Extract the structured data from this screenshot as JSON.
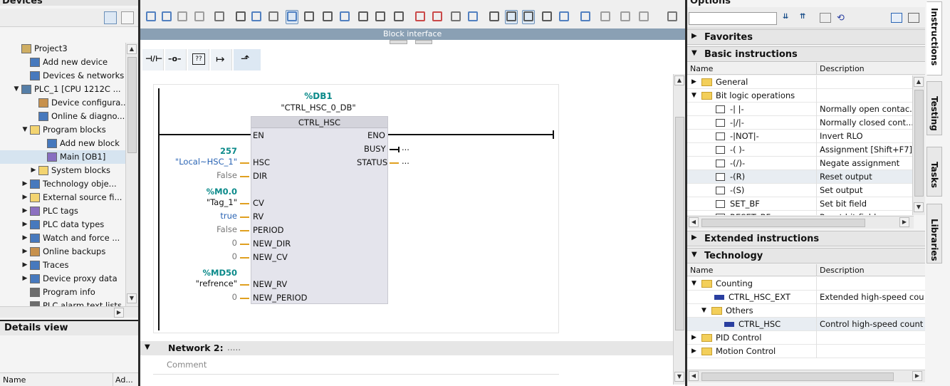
{
  "left_panel": {
    "header": "Devices",
    "tree": [
      {
        "label": "Project3",
        "expand": "",
        "icon": "project"
      },
      {
        "label": "Add new device",
        "expand": "",
        "icon": "add-device"
      },
      {
        "label": "Devices & networks",
        "expand": "",
        "icon": "network"
      },
      {
        "label": "PLC_1 [CPU 1212C ...",
        "expand": "▼",
        "icon": "plc"
      },
      {
        "label": "Device configura...",
        "expand": "",
        "icon": "device-config"
      },
      {
        "label": "Online & diagno...",
        "expand": "",
        "icon": "diagnostics"
      },
      {
        "label": "Program blocks",
        "expand": "▼",
        "icon": "folder"
      },
      {
        "label": "Add new block",
        "expand": "",
        "icon": "add-block"
      },
      {
        "label": "Main [OB1]",
        "expand": "",
        "icon": "ob-block"
      },
      {
        "label": "System blocks",
        "expand": "▶",
        "icon": "folder"
      },
      {
        "label": "Technology obje...",
        "expand": "▶",
        "icon": "technology"
      },
      {
        "label": "External source fi...",
        "expand": "▶",
        "icon": "folder"
      },
      {
        "label": "PLC tags",
        "expand": "▶",
        "icon": "tags"
      },
      {
        "label": "PLC data types",
        "expand": "▶",
        "icon": "data-types"
      },
      {
        "label": "Watch and force ...",
        "expand": "▶",
        "icon": "watch"
      },
      {
        "label": "Online backups",
        "expand": "▶",
        "icon": "backup"
      },
      {
        "label": "Traces",
        "expand": "▶",
        "icon": "traces"
      },
      {
        "label": "Device proxy data",
        "expand": "▶",
        "icon": "proxy"
      },
      {
        "label": "Program info",
        "expand": "",
        "icon": "info"
      },
      {
        "label": "PLC alarm text lists",
        "expand": "",
        "icon": "alarm"
      }
    ],
    "details_view": "Details view",
    "details_columns": [
      "Name",
      "Ad..."
    ]
  },
  "editor": {
    "block_interface_label": "Block interface",
    "instance_db_address": "%DB1",
    "instance_db_name": "\"CTRL_HSC_0_DB\"",
    "block_name": "CTRL_HSC",
    "inputs": [
      {
        "name": "EN",
        "values": []
      },
      {
        "name": "HSC",
        "values": [
          {
            "text": "257",
            "style": "teal"
          },
          {
            "text": "\"Local~HSC_1\"",
            "style": "blue"
          }
        ]
      },
      {
        "name": "DIR",
        "values": [
          {
            "text": "False",
            "style": "grey"
          }
        ]
      },
      {
        "name": "CV",
        "values": [
          {
            "text": "%M0.0",
            "style": "teal"
          },
          {
            "text": "\"Tag_1\"",
            "style": "blk"
          }
        ]
      },
      {
        "name": "RV",
        "values": [
          {
            "text": "true",
            "style": "blue"
          }
        ]
      },
      {
        "name": "PERIOD",
        "values": [
          {
            "text": "False",
            "style": "grey"
          }
        ]
      },
      {
        "name": "NEW_DIR",
        "values": [
          {
            "text": "0",
            "style": "grey"
          }
        ]
      },
      {
        "name": "NEW_CV",
        "values": [
          {
            "text": "0",
            "style": "grey"
          }
        ]
      },
      {
        "name": "NEW_RV",
        "values": [
          {
            "text": "%MD50",
            "style": "teal"
          },
          {
            "text": "\"refrence\"",
            "style": "blk"
          }
        ]
      },
      {
        "name": "NEW_PERIOD",
        "values": [
          {
            "text": "0",
            "style": "grey"
          }
        ]
      }
    ],
    "outputs": [
      {
        "name": "ENO",
        "value": ""
      },
      {
        "name": "BUSY",
        "value": "..."
      },
      {
        "name": "STATUS",
        "value": "..."
      }
    ],
    "network2_title": "Network 2:",
    "network2_dots": ".....",
    "comment_placeholder": "Comment"
  },
  "right_panel": {
    "header": "Options",
    "sections": {
      "favorites": "Favorites",
      "basic": "Basic instructions",
      "extended": "Extended instructions",
      "technology": "Technology"
    },
    "col_name": "Name",
    "col_desc": "Description",
    "basic_rows": [
      {
        "name": "General",
        "desc": "",
        "kind": "folder",
        "expand": "▶",
        "indent": 0
      },
      {
        "name": "Bit logic operations",
        "desc": "",
        "kind": "folder",
        "expand": "▼",
        "indent": 0
      },
      {
        "name": "-| |-",
        "desc": "Normally open contac...",
        "kind": "instr",
        "indent": 1
      },
      {
        "name": "-|/|-",
        "desc": "Normally closed cont...",
        "kind": "instr",
        "indent": 1
      },
      {
        "name": "-|NOT|-",
        "desc": "Invert RLO",
        "kind": "instr",
        "indent": 1
      },
      {
        "name": "-( )-",
        "desc": "Assignment [Shift+F7]",
        "kind": "instr",
        "indent": 1
      },
      {
        "name": "-(/)-",
        "desc": "Negate assignment",
        "kind": "instr",
        "indent": 1
      },
      {
        "name": "-(R)",
        "desc": "Reset output",
        "kind": "instr",
        "indent": 1
      },
      {
        "name": "-(S)",
        "desc": "Set output",
        "kind": "instr",
        "indent": 1
      },
      {
        "name": "SET_BF",
        "desc": "Set bit field",
        "kind": "instr",
        "indent": 1
      },
      {
        "name": "RESET_BF",
        "desc": "Reset bit field",
        "kind": "instr",
        "indent": 1
      }
    ],
    "tech_rows": [
      {
        "name": "Counting",
        "desc": "",
        "kind": "folder",
        "expand": "▼",
        "indent": 0
      },
      {
        "name": "CTRL_HSC_EXT",
        "desc": "Extended high-speed cou...",
        "kind": "block",
        "indent": 1
      },
      {
        "name": "Others",
        "desc": "",
        "kind": "folder",
        "expand": "▼",
        "indent": 1
      },
      {
        "name": "CTRL_HSC",
        "desc": "Control high-speed count...",
        "kind": "block",
        "indent": 2
      },
      {
        "name": "PID Control",
        "desc": "",
        "kind": "folder",
        "expand": "▶",
        "indent": 0
      },
      {
        "name": "Motion Control",
        "desc": "",
        "kind": "folder",
        "expand": "▶",
        "indent": 0
      }
    ],
    "side_tabs": [
      "Instructions",
      "Testing",
      "Tasks",
      "Libraries"
    ]
  },
  "colors": {
    "accent": "#0b8a8a",
    "selection": "#d6e4f0",
    "wire_orange": "#e0a020",
    "header_blue": "#8aa0b4"
  }
}
